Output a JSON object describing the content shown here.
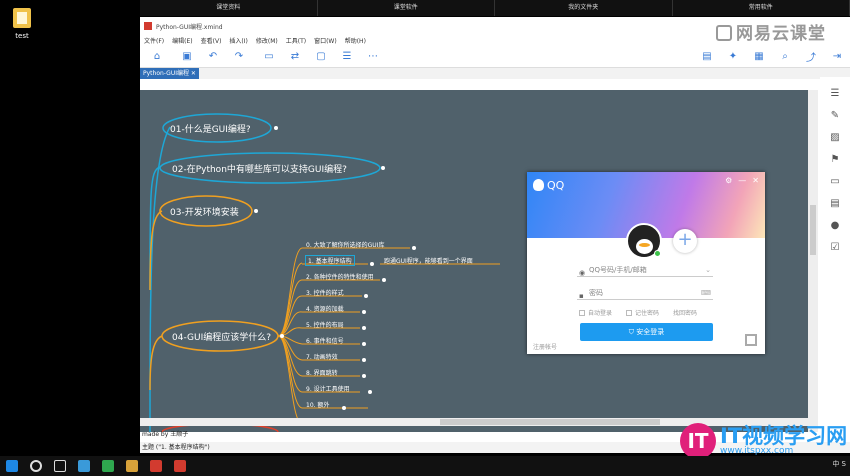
{
  "desktop": {
    "icon_label": "test"
  },
  "topbar": [
    "课堂资料",
    "课堂软件",
    "我的文件夹",
    "常用软件"
  ],
  "window": {
    "title": "Python-GUI编程.xmind",
    "brand": "网易云课堂",
    "menus": [
      "文件(F)",
      "编辑(E)",
      "查看(V)",
      "插入(I)",
      "修改(M)",
      "工具(T)",
      "窗口(W)",
      "帮助(H)"
    ],
    "tab": "Python-GUI编程",
    "made_by": "made by 王顺子",
    "status": "主题 (\"1. 基本程序结构\")"
  },
  "mindmap": {
    "topics": [
      "01-什么是GUI编程?",
      "02-在Python中有哪些库可以支持GUI编程?",
      "03-开发环境安装",
      "04-GUI编程应该学什么?"
    ],
    "subtopics": [
      "0. 大致了解你所选择的GUI库",
      "1. 基本程序结构",
      "2. 各种控件的特性和使用",
      "3. 控件的样式",
      "4. 资源的加载",
      "5. 控件的布局",
      "6. 事件和信号",
      "7. 动画特效",
      "8. 界面跳转",
      "9. 设计工具使用",
      "10. 额外"
    ],
    "note": "跑通GUI程序，能够看到一个界面"
  },
  "qq": {
    "title": "QQ",
    "account_placeholder": "QQ号码/手机/邮箱",
    "password_placeholder": "密码",
    "options": [
      "自动登录",
      "记住密码",
      "找回密码"
    ],
    "login": "安全登录",
    "register": "注册帐号"
  },
  "watermark": {
    "text": "IT视频学习网",
    "url": "www.itspxx.com"
  },
  "tray": {
    "ime": "中",
    "label": "S"
  }
}
